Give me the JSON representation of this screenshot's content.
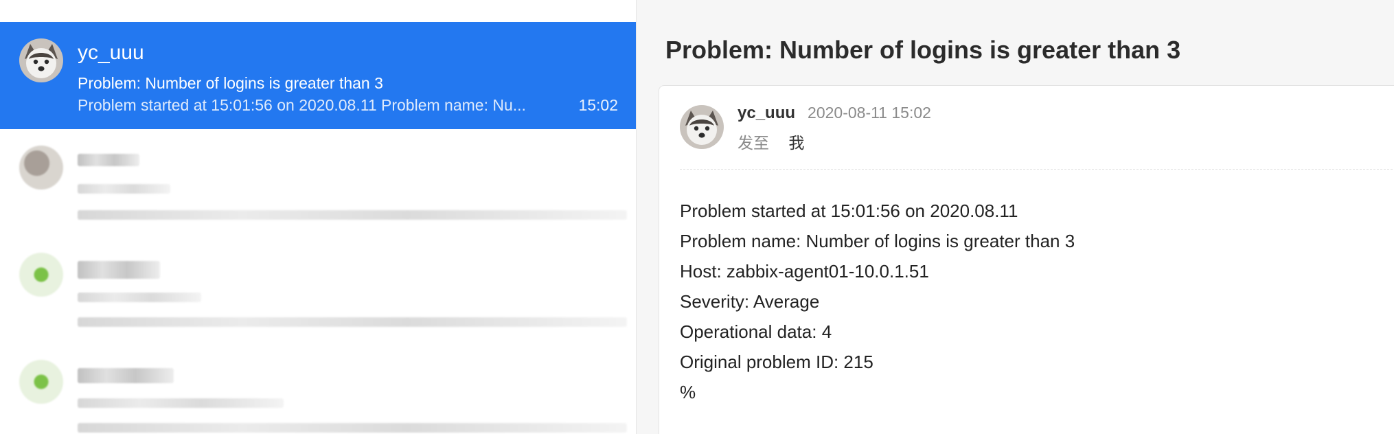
{
  "list": {
    "items": [
      {
        "sender": "yc_uuu",
        "subject": "Problem: Number of logins is greater than 3",
        "preview": "Problem started at 15:01:56 on 2020.08.11 Problem name: Nu...",
        "time": "15:02",
        "selected": true
      }
    ]
  },
  "pane": {
    "title": "Problem: Number of logins is greater than 3",
    "message": {
      "sender": "yc_uuu",
      "date": "2020-08-11 15:02",
      "to_label": "发至",
      "to_value": "我",
      "body": [
        "Problem started at 15:01:56 on 2020.08.11",
        "Problem name: Number of logins is greater than 3",
        "Host: zabbix-agent01-10.0.1.51",
        "Severity: Average",
        "Operational data: 4",
        "Original problem ID: 215",
        "%"
      ]
    }
  },
  "colors": {
    "selected_bg": "#2378f0",
    "pane_bg": "#f6f6f6"
  },
  "icons": {
    "avatar": "husky-avatar-icon"
  }
}
